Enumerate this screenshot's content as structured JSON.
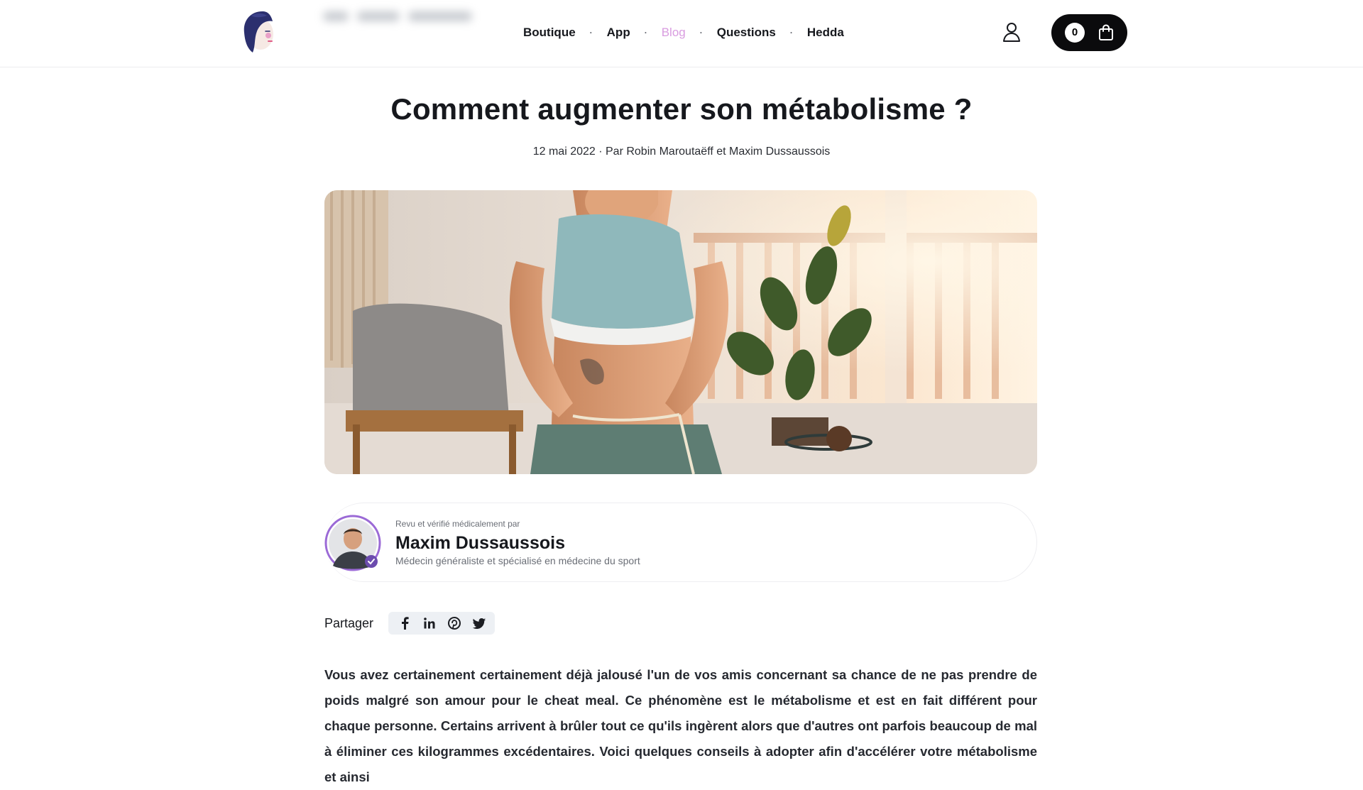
{
  "header": {
    "logo_icon": "face-logo-icon",
    "nav": [
      {
        "label": "Boutique",
        "active": false
      },
      {
        "label": "App",
        "active": false
      },
      {
        "label": "Blog",
        "active": true
      },
      {
        "label": "Questions",
        "active": false
      },
      {
        "label": "Hedda",
        "active": false
      }
    ],
    "nav_separator": "·",
    "user_icon": "user-icon",
    "cart": {
      "count": "0",
      "icon": "shopping-bag-icon"
    },
    "accent_color": "#d99ce0"
  },
  "article": {
    "title": "Comment augmenter son métabolisme ?",
    "meta": "12 mai 2022 · Par Robin Maroutaëff et Maxim Dussaussois",
    "hero_image": "woman-measuring-waist-photo"
  },
  "reviewer": {
    "label": "Revu et vérifié médicalement par",
    "name": "Maxim Dussaussois",
    "title": "Médecin généraliste et spécialisé en médecine du sport",
    "ring_color": "#9b6ad6"
  },
  "share": {
    "label": "Partager",
    "icons": [
      "facebook-icon",
      "linkedin-icon",
      "pinterest-icon",
      "twitter-icon"
    ]
  },
  "body": {
    "intro": "Vous avez certainement certainement déjà jalousé l'un de vos amis concernant sa chance de ne pas prendre de poids malgré son amour pour le cheat meal. Ce phénomène est le métabolisme et est en fait différent pour chaque personne. Certains arrivent à brûler tout ce qu'ils ingèrent alors que d'autres ont parfois beaucoup de mal à éliminer ces kilogrammes excédentaires. Voici quelques conseils à adopter afin d'accélérer votre métabolisme et ainsi"
  }
}
